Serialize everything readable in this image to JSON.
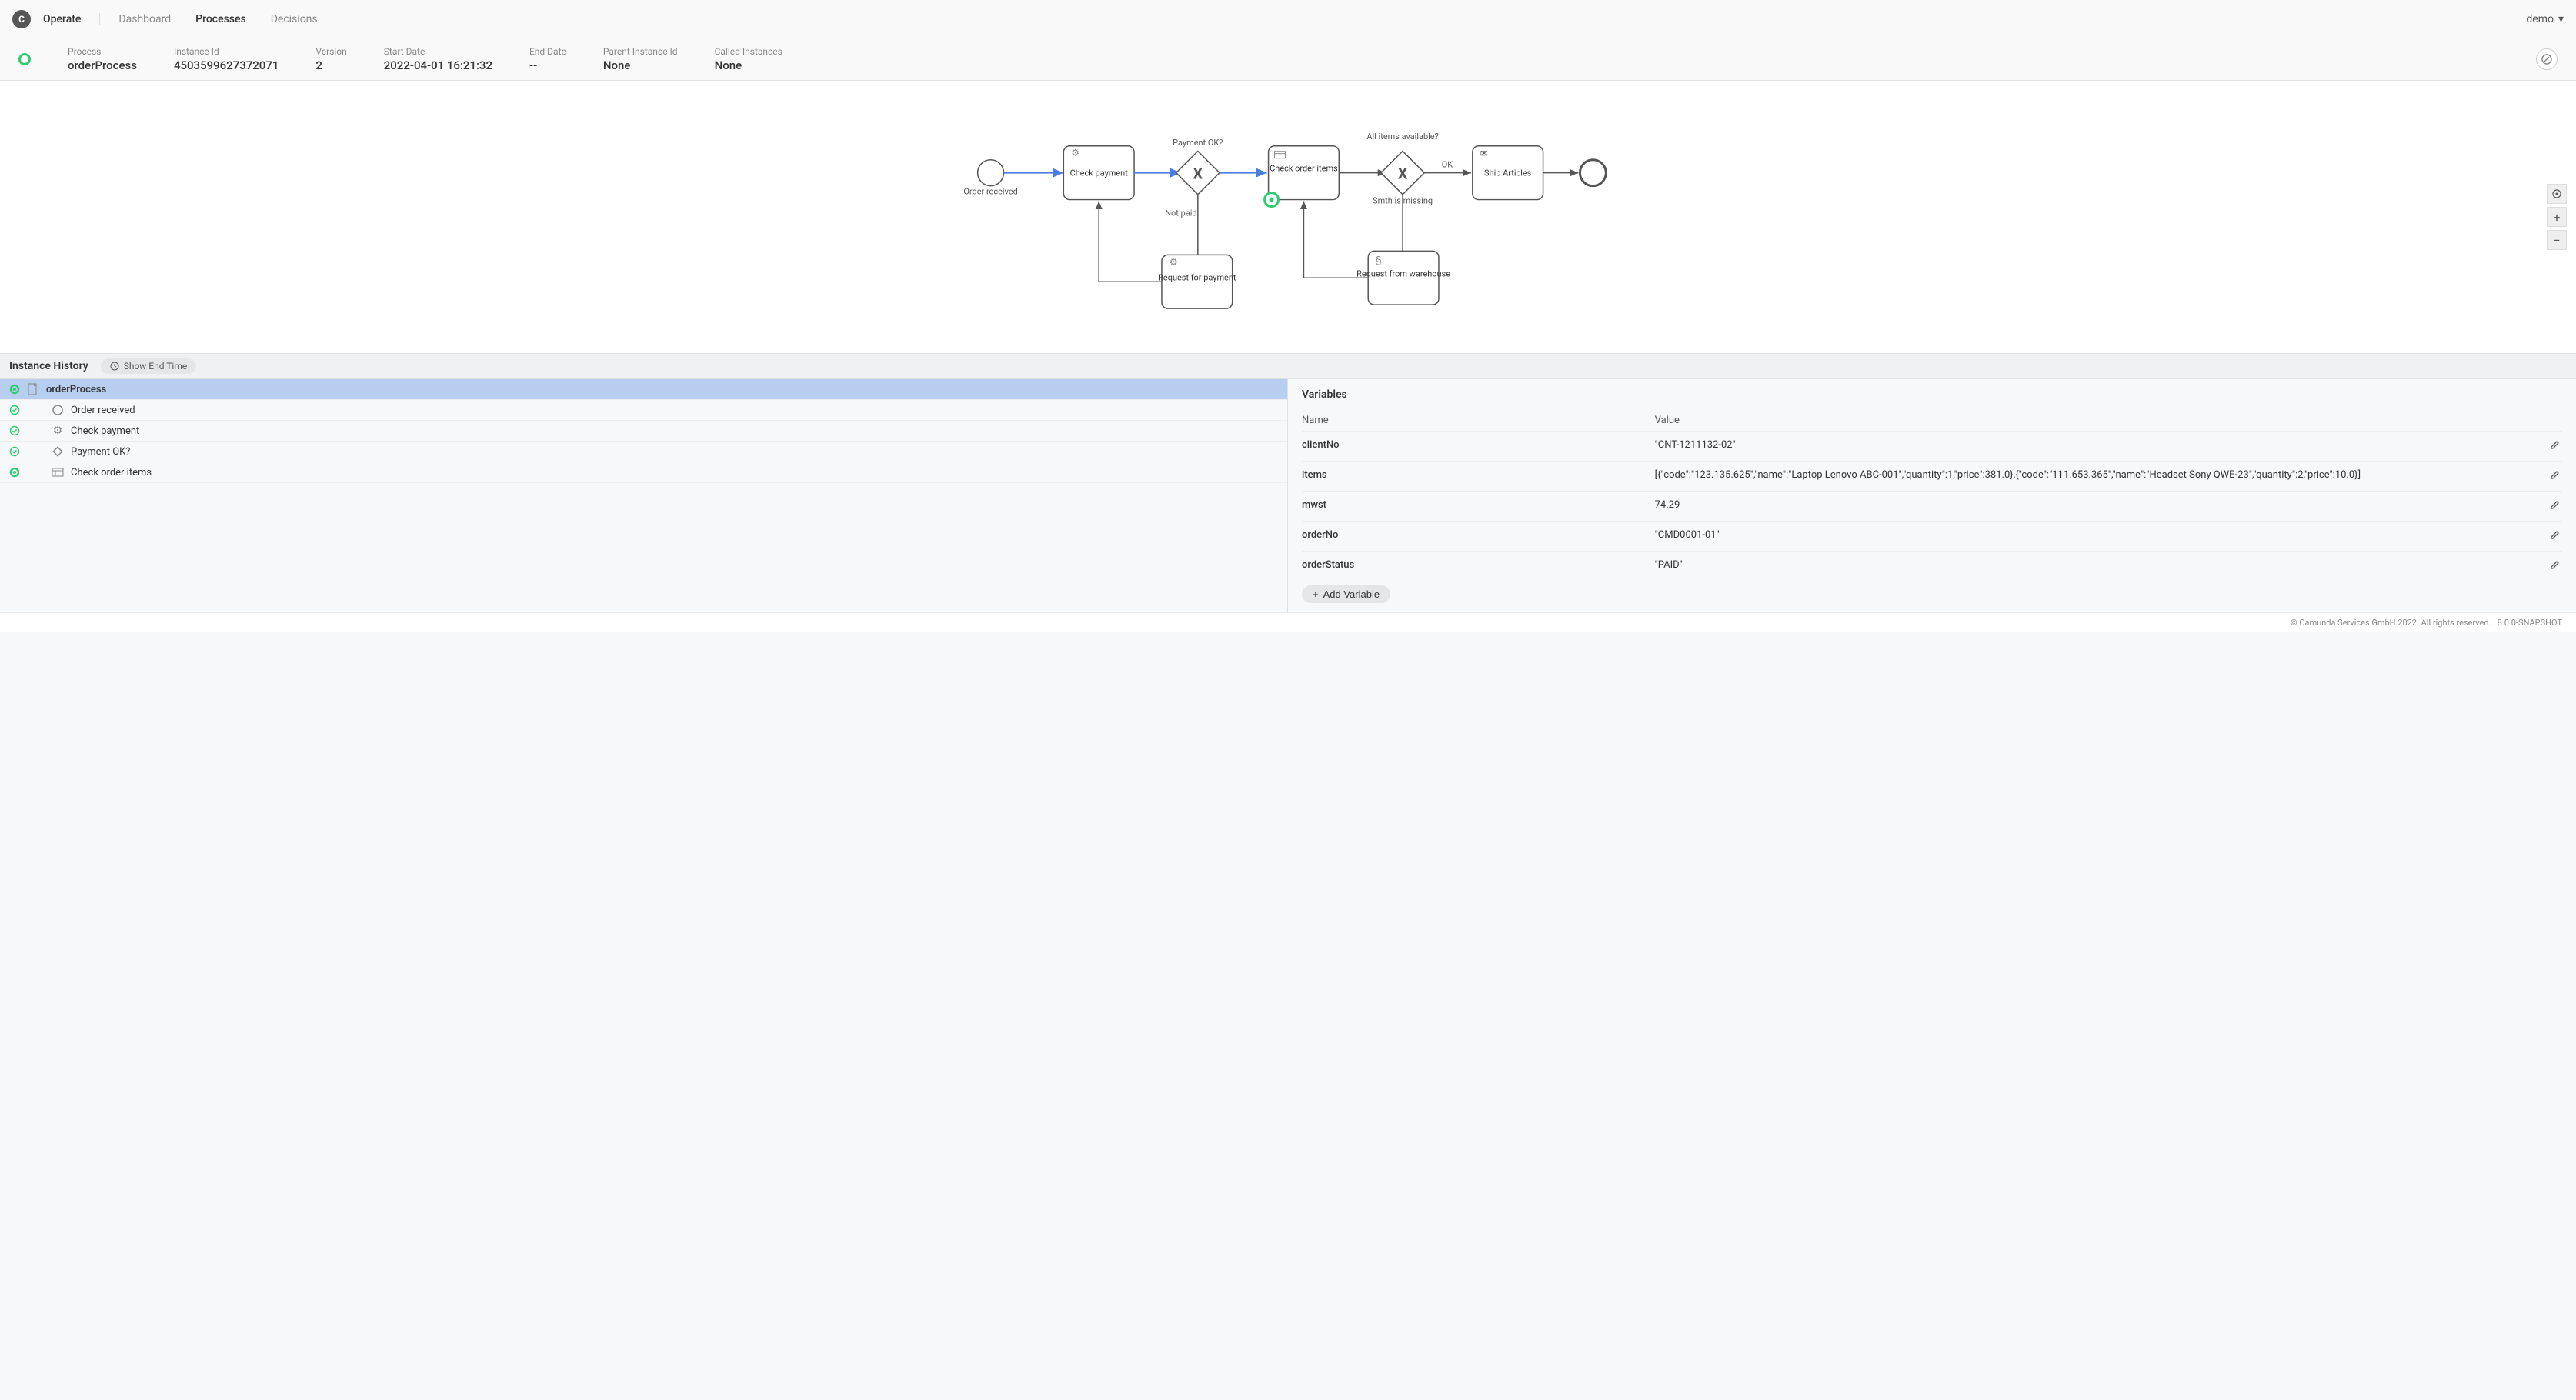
{
  "header": {
    "app_name": "Operate",
    "nav": [
      "Dashboard",
      "Processes",
      "Decisions"
    ],
    "active_nav": "Processes",
    "user": "demo"
  },
  "info": {
    "process_label": "Process",
    "process_value": "orderProcess",
    "instance_label": "Instance Id",
    "instance_value": "4503599627372071",
    "version_label": "Version",
    "version_value": "2",
    "start_label": "Start Date",
    "start_value": "2022-04-01 16:21:32",
    "end_label": "End Date",
    "end_value": "--",
    "parent_label": "Parent Instance Id",
    "parent_value": "None",
    "called_label": "Called Instances",
    "called_value": "None"
  },
  "diagram": {
    "start_event": "Order received",
    "task_check_payment": "Check payment",
    "gateway_payment_label": "Payment OK?",
    "gateway_payment_not_paid": "Not paid",
    "task_check_order": "Check order items",
    "gateway_items_label": "All items available?",
    "gateway_items_ok": "OK",
    "gateway_items_missing": "Smth is missing",
    "task_ship": "Ship Articles",
    "task_request_payment": "Request for payment",
    "task_request_warehouse": "Request from warehouse"
  },
  "history": {
    "panel_title": "Instance History",
    "show_end_time": "Show End Time",
    "items": [
      {
        "label": "orderProcess",
        "status": "active",
        "icon": "document",
        "selected": true,
        "indent": 0
      },
      {
        "label": "Order received",
        "status": "done",
        "icon": "circle",
        "indent": 1
      },
      {
        "label": "Check payment",
        "status": "done",
        "icon": "gear",
        "indent": 1
      },
      {
        "label": "Payment OK?",
        "status": "done",
        "icon": "diamond",
        "indent": 1
      },
      {
        "label": "Check order items",
        "status": "active",
        "icon": "form",
        "indent": 1
      }
    ]
  },
  "variables": {
    "title": "Variables",
    "col_name": "Name",
    "col_value": "Value",
    "rows": [
      {
        "name": "clientNo",
        "value": "\"CNT-1211132-02\""
      },
      {
        "name": "items",
        "value": "[{\"code\":\"123.135.625\",\"name\":\"Laptop Lenovo ABC-001\",\"quantity\":1,\"price\":381.0},{\"code\":\"111.653.365\",\"name\":\"Headset Sony QWE-23\",\"quantity\":2,\"price\":10.0}]"
      },
      {
        "name": "mwst",
        "value": "74.29"
      },
      {
        "name": "orderNo",
        "value": "\"CMD0001-01\""
      },
      {
        "name": "orderStatus",
        "value": "\"PAID\""
      }
    ],
    "add_button": "Add Variable"
  },
  "footer": "© Camunda Services GmbH 2022. All rights reserved. | 8.0.0-SNAPSHOT"
}
